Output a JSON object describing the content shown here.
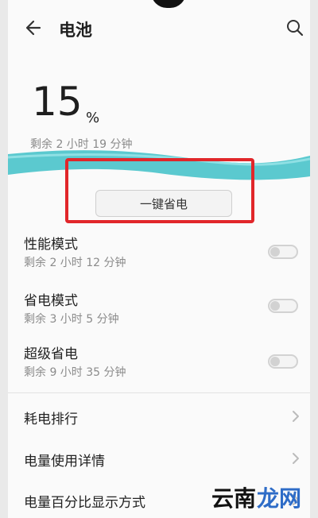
{
  "header": {
    "title": "电池"
  },
  "battery": {
    "percent": "15",
    "percent_unit": "%",
    "remaining": "剩余 2 小时 19 分钟",
    "wave_color": "#5bc9cf",
    "save_button_label": "一键省电",
    "highlight_color": "#e1262a"
  },
  "modes": [
    {
      "title": "性能模式",
      "subtitle": "剩余 2 小时 12 分钟",
      "enabled": false
    },
    {
      "title": "省电模式",
      "subtitle": "剩余 3 小时 5 分钟",
      "enabled": false
    },
    {
      "title": "超级省电",
      "subtitle": "剩余 9 小时 35 分钟",
      "enabled": false
    }
  ],
  "links": [
    {
      "label": "耗电排行"
    },
    {
      "label": "电量使用详情"
    },
    {
      "label": "电量百分比显示方式"
    }
  ],
  "watermark": {
    "left": "云南",
    "right": "龙网"
  }
}
